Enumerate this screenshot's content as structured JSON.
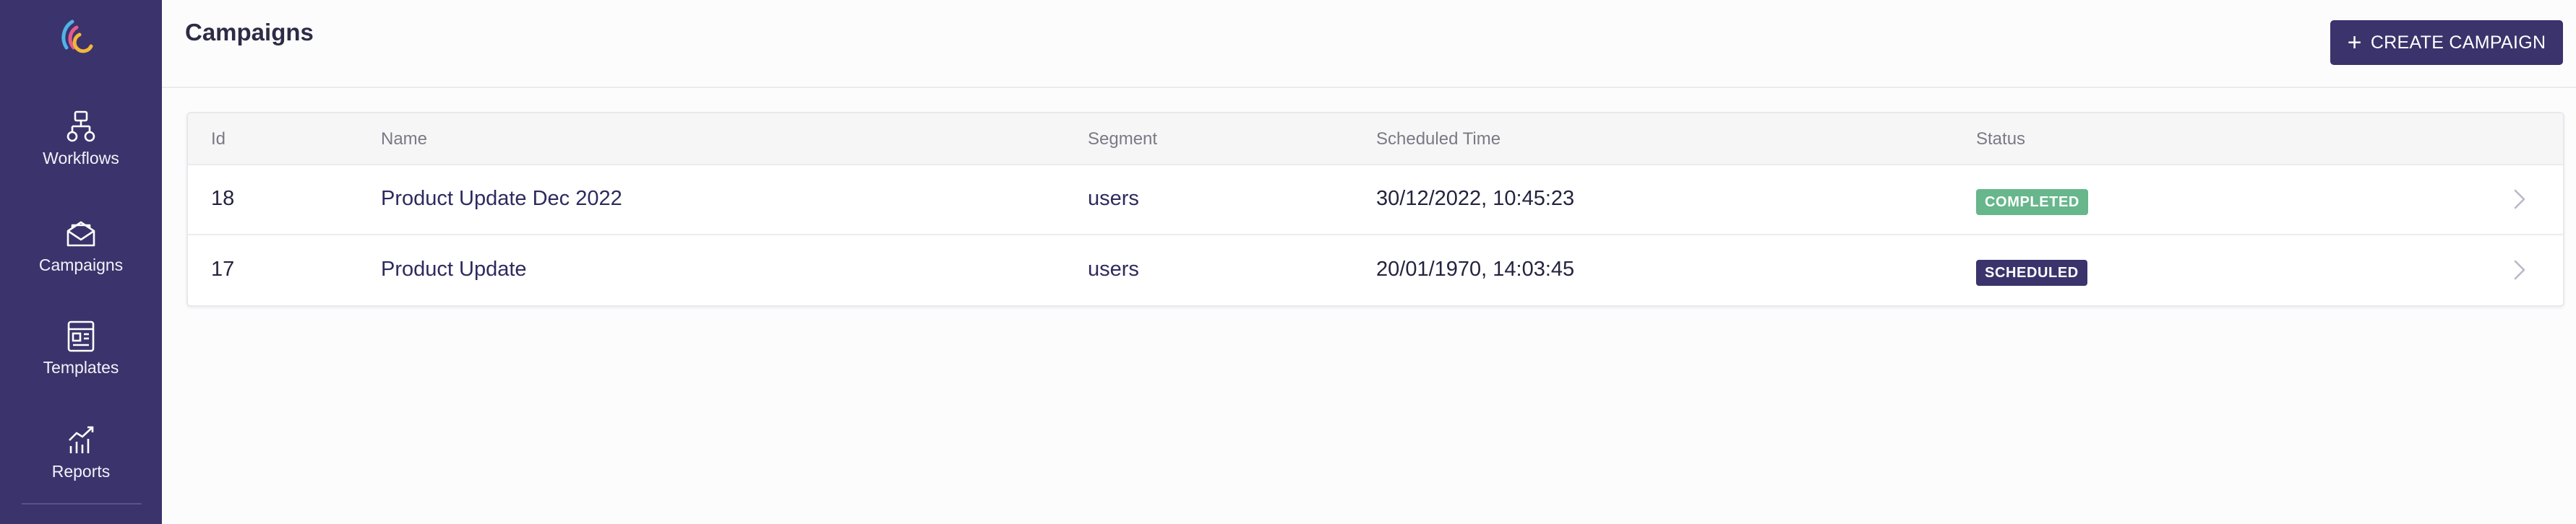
{
  "sidebar": {
    "items": [
      {
        "label": "Workflows",
        "icon": "workflow-icon"
      },
      {
        "label": "Campaigns",
        "icon": "campaign-envelope-icon"
      },
      {
        "label": "Templates",
        "icon": "template-icon"
      },
      {
        "label": "Reports",
        "icon": "reports-chart-icon"
      }
    ]
  },
  "header": {
    "title": "Campaigns",
    "create_label": "CREATE CAMPAIGN"
  },
  "table": {
    "columns": [
      "Id",
      "Name",
      "Segment",
      "Scheduled Time",
      "Status"
    ],
    "rows": [
      {
        "id": "18",
        "name": "Product Update Dec 2022",
        "segment": "users",
        "scheduled_time": "30/12/2022, 10:45:23",
        "status": "COMPLETED"
      },
      {
        "id": "17",
        "name": "Product Update",
        "segment": "users",
        "scheduled_time": "20/01/1970, 14:03:45",
        "status": "SCHEDULED"
      }
    ]
  },
  "colors": {
    "sidebar": "#3b336b",
    "accent": "#3b336b",
    "completed": "#67b68c",
    "scheduled": "#3b336b"
  }
}
